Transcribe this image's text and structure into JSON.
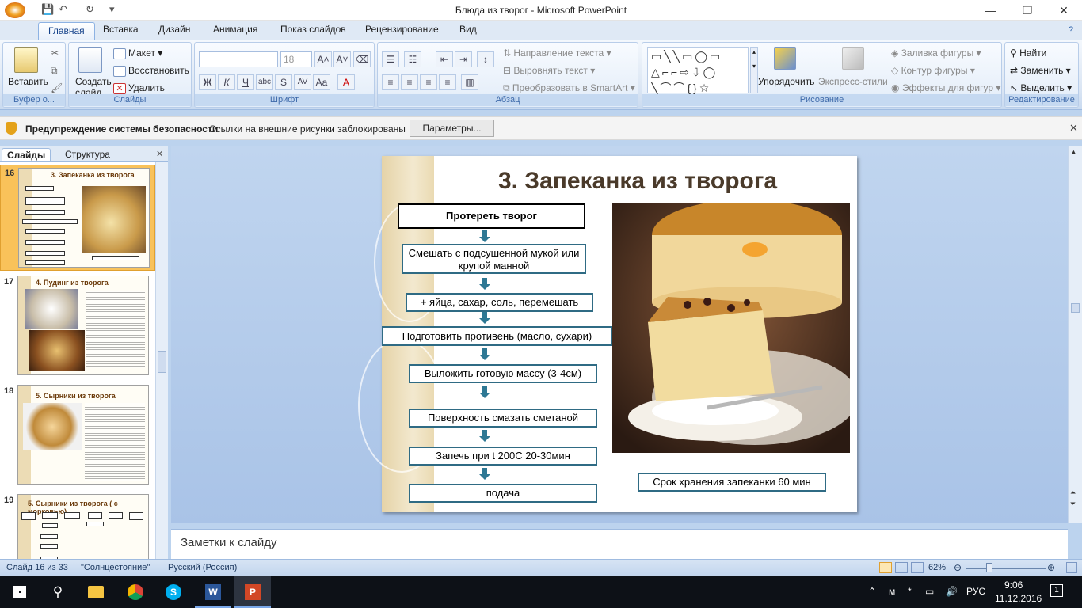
{
  "window": {
    "title": "Блюда из творог - Microsoft PowerPoint"
  },
  "tabs": [
    "Главная",
    "Вставка",
    "Дизайн",
    "Анимация",
    "Показ слайдов",
    "Рецензирование",
    "Вид"
  ],
  "ribbon": {
    "clipboard": {
      "paste": "Вставить",
      "label": "Буфер о..."
    },
    "slides": {
      "new_slide": "Создать слайд",
      "layout": "Макет",
      "reset": "Восстановить",
      "delete": "Удалить",
      "label": "Слайды"
    },
    "font": {
      "size": "18",
      "label": "Шрифт"
    },
    "paragraph": {
      "text_direction": "Направление текста",
      "align_text": "Выровнять текст",
      "smartart": "Преобразовать в SmartArt",
      "label": "Абзац"
    },
    "drawing": {
      "arrange": "Упорядочить",
      "quick_styles": "Экспресс-стили",
      "fill": "Заливка фигуры",
      "outline": "Контур фигуры",
      "effects": "Эффекты для фигур",
      "label": "Рисование"
    },
    "editing": {
      "find": "Найти",
      "replace": "Заменить",
      "select": "Выделить",
      "label": "Редактирование"
    }
  },
  "security": {
    "title": "Предупреждение системы безопасности",
    "message": "Ссылки на внешние рисунки заблокированы",
    "button": "Параметры..."
  },
  "panel_tabs": {
    "slides": "Слайды",
    "outline": "Структура"
  },
  "thumbnails": [
    {
      "num": "16",
      "title": "3. Запеканка из творога",
      "selected": true
    },
    {
      "num": "17",
      "title": "4. Пудинг из творога"
    },
    {
      "num": "18",
      "title": "5. Сырники из творога"
    },
    {
      "num": "19",
      "title": "5. Сырники из творога ( с морковью)"
    }
  ],
  "slide": {
    "title": "3. Запеканка из творога",
    "steps": [
      "Протереть творог",
      "Смешать с подсушенной мукой или крупой манной",
      "+ яйца, сахар, соль, перемешать",
      "Подготовить противень (масло, сухари)",
      "Выложить готовую массу (3-4см)",
      "Поверхность смазать сметаной",
      "Запечь при t 200С 20-30мин",
      "подача"
    ],
    "storage_note": "Срок хранения запеканки 60 мин"
  },
  "notes": {
    "placeholder": "Заметки к слайду"
  },
  "status": {
    "slide": "Слайд 16 из 33",
    "theme": "\"Солнцестояние\"",
    "language": "Русский (Россия)",
    "zoom": "62%"
  },
  "taskbar": {
    "lang": "РУС",
    "time": "9:06",
    "date": "11.12.2016",
    "notif_count": "1"
  }
}
